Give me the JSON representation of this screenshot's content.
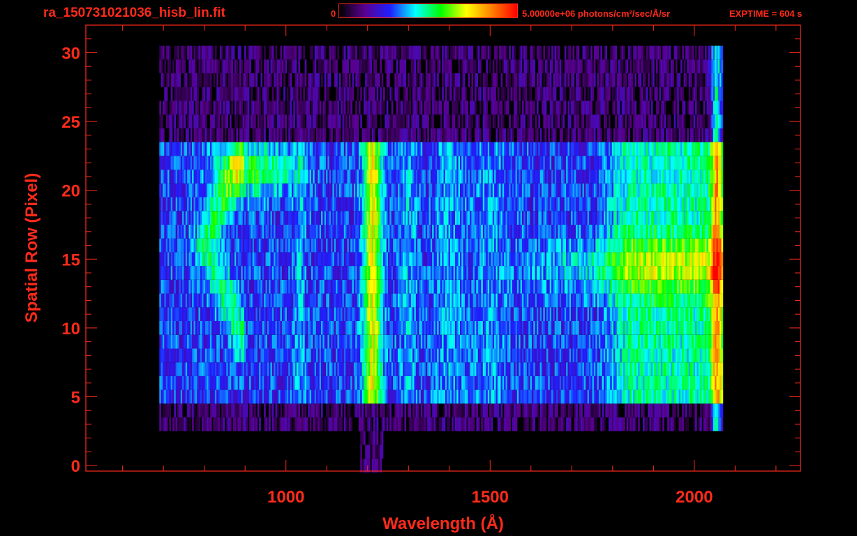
{
  "header": {
    "file_title": "ra_150731021036_hisb_lin.fit",
    "colorbar_min_label": "0",
    "colorbar_max_label": "5.00000e+06 photons/cm²/sec/Å/sr",
    "exptime_label": "EXPTIME = 604 s"
  },
  "colors": {
    "background": "#000000",
    "axes": "#ff2a1a",
    "colormap": [
      "#000000",
      "#5a0090",
      "#1f1fff",
      "#00ffff",
      "#00ff00",
      "#ffff00",
      "#ff8000",
      "#ff0000"
    ]
  },
  "chart_data": {
    "type": "heatmap",
    "title": "",
    "xlabel": "Wavelength (Å)",
    "ylabel": "Spatial Row (Pixel)",
    "xlim": [
      510,
      2260
    ],
    "ylim": [
      -0.4,
      32
    ]
  }
}
